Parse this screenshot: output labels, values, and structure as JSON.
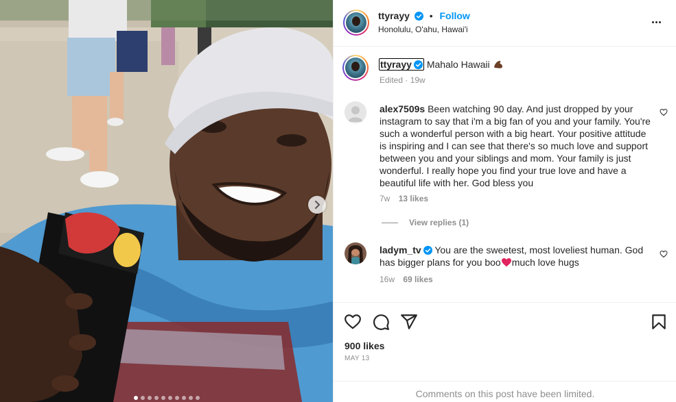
{
  "post": {
    "username": "ttyrayy",
    "follow_label": "Follow",
    "separator": "•",
    "location": "Honolulu, O'ahu, Hawai'i",
    "caption_text": "Mahalo Hawaii",
    "caption_meta": "Edited · 19w"
  },
  "comments": [
    {
      "username": "alex7509s",
      "text": "Been watching 90 day. And just dropped by your instagram to say that i'm a big fan of you and your family. You're such a wonderful person with a big heart. Your positive attitude is inspiring and I can see that there's so much love and support between you and your siblings and mom. Your family is just wonderful. I really hope you find your true love and have a beautiful life with her. God bless you",
      "age": "7w",
      "likes": "13 likes",
      "view_replies": "View replies (1)"
    },
    {
      "username": "ladym_tv",
      "text_before": "You are the sweetest, most loveliest human. God has bigger plans for you boo",
      "text_after": "much love hugs",
      "age": "16w",
      "likes": "69 likes"
    }
  ],
  "engagement": {
    "likes": "900 likes",
    "date": "MAY 13",
    "comments_limited": "Comments on this post have been limited."
  },
  "icons": {
    "like": "heart-icon",
    "comment": "comment-icon",
    "share": "share-icon",
    "save": "bookmark-icon",
    "more": "more-options-icon",
    "next": "chevron-right-icon",
    "verified": "verified-badge-icon"
  },
  "colors": {
    "link_blue": "#0095f6",
    "verified_blue": "#0095f6",
    "muted_text": "#8e8e8e",
    "divider": "#efefef",
    "heart_red": "#e0245e"
  }
}
